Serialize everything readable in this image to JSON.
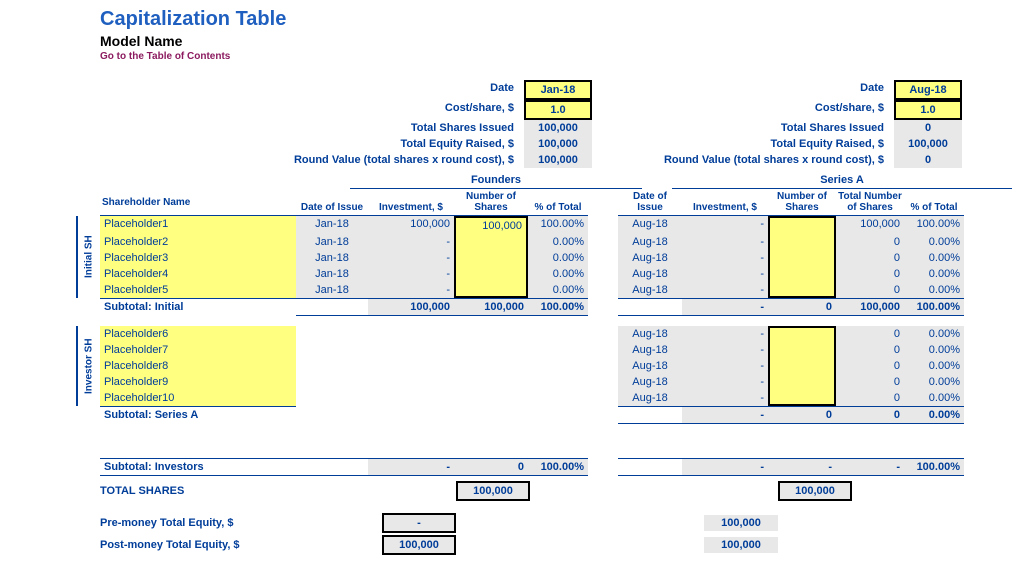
{
  "header": {
    "title": "Capitalization Table",
    "model_name": "Model Name",
    "toc_link": "Go to the Table of Contents"
  },
  "round_summary_labels": {
    "date": "Date",
    "cost": "Cost/share, $",
    "shares_issued": "Total Shares Issued",
    "equity_raised": "Total Equity Raised, $",
    "round_value": "Round Value (total shares x round cost), $"
  },
  "rounds": {
    "founders": {
      "title": "Founders",
      "date": "Jan-18",
      "cost": "1.0",
      "shares_issued": "100,000",
      "equity_raised": "100,000",
      "round_value": "100,000"
    },
    "seriesa": {
      "title": "Series A",
      "date": "Aug-18",
      "cost": "1.0",
      "shares_issued": "0",
      "equity_raised": "100,000",
      "round_value": "0"
    }
  },
  "columns": {
    "shareholder": "Shareholder Name",
    "date_issue": "Date of Issue",
    "investment": "Investment, $",
    "num_shares": "Number of Shares",
    "pct_total": "% of Total",
    "total_num_shares": "Total Number of Shares"
  },
  "groups": {
    "initial": {
      "label": "Initial SH"
    },
    "investor": {
      "label": "Investor SH"
    }
  },
  "initial_rows": [
    {
      "name": "Placeholder1",
      "f_date": "Jan-18",
      "f_inv": "100,000",
      "f_sh": "100,000",
      "f_pct": "100.00%",
      "s_date": "Aug-18",
      "s_inv": "-",
      "s_sh": "",
      "s_tot": "100,000",
      "s_pct": "100.00%"
    },
    {
      "name": "Placeholder2",
      "f_date": "Jan-18",
      "f_inv": "-",
      "f_sh": "",
      "f_pct": "0.00%",
      "s_date": "Aug-18",
      "s_inv": "-",
      "s_sh": "",
      "s_tot": "0",
      "s_pct": "0.00%"
    },
    {
      "name": "Placeholder3",
      "f_date": "Jan-18",
      "f_inv": "-",
      "f_sh": "",
      "f_pct": "0.00%",
      "s_date": "Aug-18",
      "s_inv": "-",
      "s_sh": "",
      "s_tot": "0",
      "s_pct": "0.00%"
    },
    {
      "name": "Placeholder4",
      "f_date": "Jan-18",
      "f_inv": "-",
      "f_sh": "",
      "f_pct": "0.00%",
      "s_date": "Aug-18",
      "s_inv": "-",
      "s_sh": "",
      "s_tot": "0",
      "s_pct": "0.00%"
    },
    {
      "name": "Placeholder5",
      "f_date": "Jan-18",
      "f_inv": "-",
      "f_sh": "",
      "f_pct": "0.00%",
      "s_date": "Aug-18",
      "s_inv": "-",
      "s_sh": "",
      "s_tot": "0",
      "s_pct": "0.00%"
    }
  ],
  "subtotal_initial": {
    "label": "Subtotal: Initial",
    "f_inv": "100,000",
    "f_sh": "100,000",
    "f_pct": "100.00%",
    "s_inv": "-",
    "s_sh": "0",
    "s_tot": "100,000",
    "s_pct": "100.00%"
  },
  "investor_rows": [
    {
      "name": "Placeholder6",
      "s_date": "Aug-18",
      "s_inv": "-",
      "s_sh": "",
      "s_tot": "0",
      "s_pct": "0.00%"
    },
    {
      "name": "Placeholder7",
      "s_date": "Aug-18",
      "s_inv": "-",
      "s_sh": "",
      "s_tot": "0",
      "s_pct": "0.00%"
    },
    {
      "name": "Placeholder8",
      "s_date": "Aug-18",
      "s_inv": "-",
      "s_sh": "",
      "s_tot": "0",
      "s_pct": "0.00%"
    },
    {
      "name": "Placeholder9",
      "s_date": "Aug-18",
      "s_inv": "-",
      "s_sh": "",
      "s_tot": "0",
      "s_pct": "0.00%"
    },
    {
      "name": "Placeholder10",
      "s_date": "Aug-18",
      "s_inv": "-",
      "s_sh": "",
      "s_tot": "0",
      "s_pct": "0.00%"
    }
  ],
  "subtotal_seriesa": {
    "label": "Subtotal: Series A",
    "s_inv": "-",
    "s_sh": "0",
    "s_tot": "0",
    "s_pct": "0.00%"
  },
  "subtotal_investors": {
    "label": "Subtotal: Investors",
    "f_inv": "-",
    "f_sh": "0",
    "f_pct": "100.00%",
    "s_inv": "-",
    "s_sh": "-",
    "s_tot": "-",
    "s_pct": "100.00%"
  },
  "totals": {
    "total_shares_label": "TOTAL SHARES",
    "total_shares_f": "100,000",
    "total_shares_s": "100,000",
    "pre_label": "Pre-money Total Equity, $",
    "post_label": "Post-money Total Equity, $",
    "pre_f": "-",
    "post_f": "100,000",
    "pre_s": "100,000",
    "post_s": "100,000"
  }
}
